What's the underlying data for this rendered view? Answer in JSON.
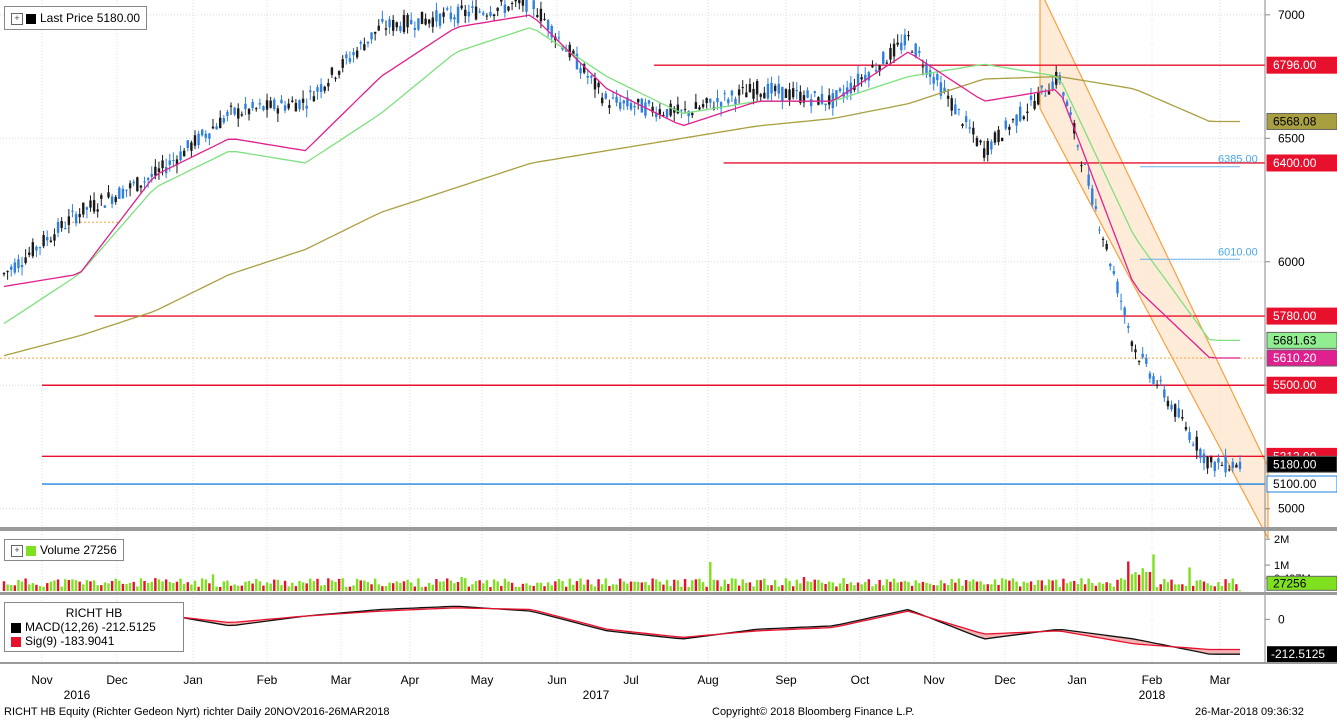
{
  "legend": {
    "price_label": "Last Price",
    "price_value": "5180.00",
    "volume_label": "Volume",
    "volume_value": "27256",
    "macd_title": "RICHT HB",
    "macd_label": "MACD(12,26)",
    "macd_value": "-212.5125",
    "sig_label": "Sig(9)",
    "sig_value": "-183.9041"
  },
  "footer": {
    "left": "RICHT HB Equity (Richter Gedeon Nyrt) richter  Daily 20NOV2016-26MAR2018",
    "center": "Copyright© 2018 Bloomberg Finance L.P.",
    "right": "26-Mar-2018 09:36:32"
  },
  "colors": {
    "candle_up": "#1a1a1a",
    "candle_down": "#2e7fe0",
    "ma_pink": "#e0208e",
    "ma_green": "#7ee07e",
    "ma_olive": "#a8a040",
    "level_red": "#e8112d",
    "level_blue": "#1f82e0",
    "channel": "#f8a040",
    "volume_green": "#7fe020",
    "volume_red": "#e8112d"
  },
  "chart_data": {
    "type": "line",
    "title": "",
    "x_tick_labels": [
      "Nov",
      "Dec",
      "Jan",
      "Feb",
      "Mar",
      "Apr",
      "May",
      "Jun",
      "Jul",
      "Aug",
      "Sep",
      "Oct",
      "Nov",
      "Dec",
      "Jan",
      "Feb",
      "Mar"
    ],
    "year_labels": [
      "2016",
      "2017",
      "2018"
    ],
    "price_axis": {
      "ylim": [
        4930,
        7060
      ],
      "ticks": [
        "5000",
        "5500",
        "6000",
        "6500",
        "7000"
      ],
      "tick_values": [
        5000,
        5500,
        6000,
        6500,
        7000
      ]
    },
    "x_months": [
      0,
      1,
      2,
      3,
      4,
      5,
      6,
      7,
      8,
      9,
      10,
      11,
      12,
      13,
      14,
      15,
      16
    ],
    "price_monthly": [
      5950,
      6200,
      6350,
      6600,
      6650,
      6950,
      7000,
      7050,
      6650,
      6600,
      6700,
      6650,
      6900,
      6450,
      6750,
      5650,
      5180
    ],
    "ma_pink": [
      5900,
      5950,
      6350,
      6500,
      6450,
      6750,
      6950,
      7000,
      6700,
      6550,
      6650,
      6650,
      6850,
      6650,
      6700,
      5900,
      5610.2
    ],
    "ma_green": [
      5750,
      5950,
      6300,
      6450,
      6400,
      6600,
      6850,
      6950,
      6750,
      6600,
      6650,
      6650,
      6750,
      6800,
      6750,
      6100,
      5681.63
    ],
    "ma_olive": [
      5620,
      5700,
      5800,
      5950,
      6050,
      6200,
      6300,
      6400,
      6450,
      6500,
      6550,
      6580,
      6640,
      6740,
      6750,
      6700,
      6568.08
    ],
    "levels": [
      {
        "label": "6796.00",
        "value": 6796.0,
        "kind": "red",
        "from_month": 8.3
      },
      {
        "label": "6400.00",
        "value": 6400.0,
        "kind": "red",
        "from_month": 9.2
      },
      {
        "label": "5780.00",
        "value": 5780.0,
        "kind": "red",
        "from_month": 0.7
      },
      {
        "label": "5500.00",
        "value": 5500.0,
        "kind": "red",
        "from_month": 0.0
      },
      {
        "label": "5212.00",
        "value": 5212.0,
        "kind": "red",
        "from_month": 0.0
      },
      {
        "label": "5100.00",
        "value": 5100.0,
        "kind": "blue",
        "from_month": 0.0
      }
    ],
    "fib_labels": [
      {
        "label": "6385.00",
        "value": 6385
      },
      {
        "label": "6010.00",
        "value": 6010
      }
    ],
    "series_tags": [
      {
        "label": "6568.08",
        "value": 6568.08,
        "bg": "#a8a040"
      },
      {
        "label": "5681.63",
        "value": 5681.63,
        "bg": "#90ee90"
      },
      {
        "label": "5610.20",
        "value": 5610.2,
        "bg": "#e0208e"
      },
      {
        "label": "5180.00",
        "value": 5180.0,
        "bg": "#000000"
      }
    ],
    "volume_axis": {
      "ticks": [
        "2M",
        "1M",
        "0.497M"
      ],
      "tick_values": [
        2000000,
        1000000,
        497000
      ]
    },
    "volume_last": 27256,
    "macd_axis": {
      "ticks": [
        "0"
      ],
      "tick_values": [
        0
      ]
    },
    "macd_monthly": [
      60,
      0,
      40,
      -40,
      20,
      60,
      80,
      50,
      -70,
      -120,
      -60,
      -40,
      60,
      -120,
      -60,
      -120,
      -212.5125
    ],
    "sig_monthly": [
      50,
      20,
      30,
      -20,
      20,
      50,
      70,
      60,
      -60,
      -110,
      -70,
      -50,
      50,
      -90,
      -70,
      -150,
      -183.9041
    ]
  }
}
